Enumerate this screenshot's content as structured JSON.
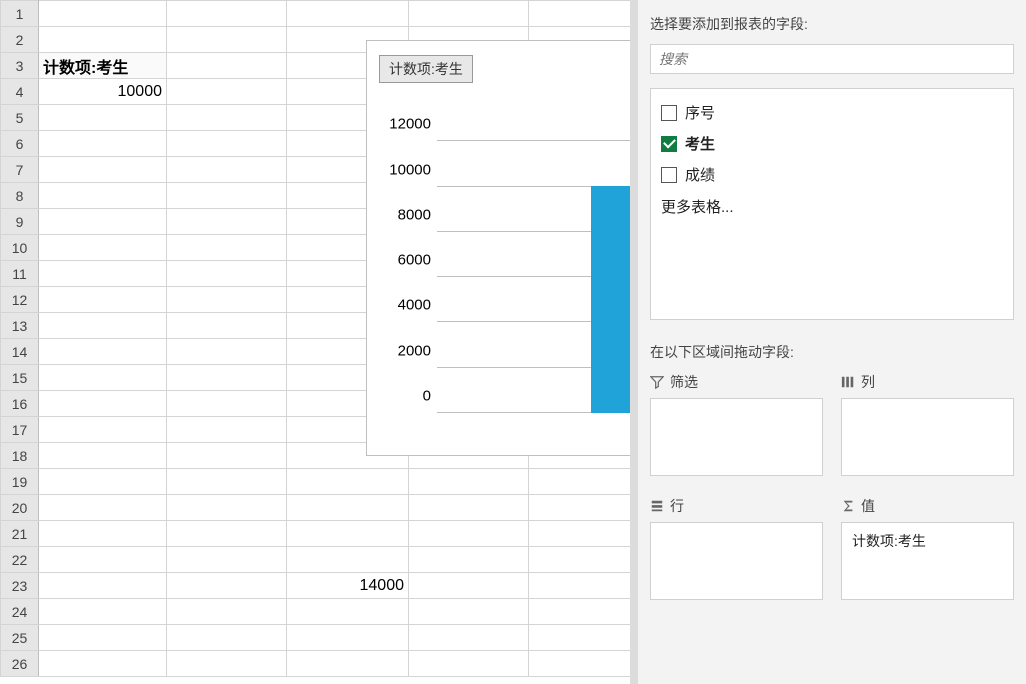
{
  "sheet": {
    "row_numbers": [
      "1",
      "2",
      "3",
      "4",
      "5",
      "6",
      "7",
      "8",
      "9",
      "10",
      "11",
      "12",
      "13",
      "14",
      "15",
      "16",
      "17",
      "18",
      "19",
      "20",
      "21",
      "22",
      "23",
      "24",
      "25",
      "26"
    ],
    "pivot_header": "计数项:考生",
    "pivot_value": "10000",
    "extra_value": "14000"
  },
  "chart_data": {
    "type": "bar",
    "title": "计数项:考生",
    "categories": [
      ""
    ],
    "values": [
      10000
    ],
    "ylim": [
      0,
      12000
    ],
    "yticks": [
      0,
      2000,
      4000,
      6000,
      8000,
      10000,
      12000
    ]
  },
  "panel": {
    "choose_fields_label": "选择要添加到报表的字段:",
    "search_placeholder": "搜索",
    "fields": {
      "f0": {
        "label": "序号",
        "checked": false
      },
      "f1": {
        "label": "考生",
        "checked": true
      },
      "f2": {
        "label": "成绩",
        "checked": false
      }
    },
    "more_tables": "更多表格...",
    "drag_label": "在以下区域间拖动字段:",
    "areas": {
      "filter": {
        "label": "筛选"
      },
      "columns": {
        "label": "列"
      },
      "rows": {
        "label": "行"
      },
      "values": {
        "label": "值",
        "items": {
          "v0": "计数项:考生"
        }
      }
    }
  }
}
